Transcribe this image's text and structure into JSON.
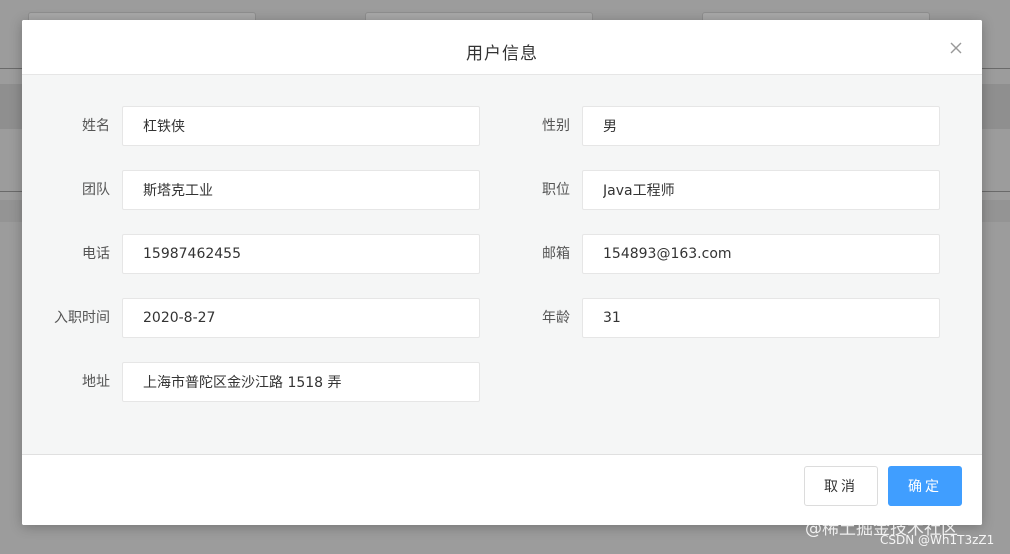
{
  "dialog": {
    "title": "用户信息",
    "close_icon": "close-icon"
  },
  "form": {
    "fields": [
      {
        "label": "姓名",
        "value": "杠铁侠"
      },
      {
        "label": "性别",
        "value": "男"
      },
      {
        "label": "团队",
        "value": "斯塔克工业"
      },
      {
        "label": "职位",
        "value": "Java工程师"
      },
      {
        "label": "电话",
        "value": "15987462455"
      },
      {
        "label": "邮箱",
        "value": "154893@163.com"
      },
      {
        "label": "入职时间",
        "value": "2020-8-27"
      },
      {
        "label": "年龄",
        "value": "31"
      },
      {
        "label": "地址",
        "value": "上海市普陀区金沙江路 1518 弄"
      }
    ]
  },
  "footer": {
    "cancel_label": "取消",
    "confirm_label": "确定"
  },
  "colors": {
    "primary": "#409eff",
    "body_bg": "#f5f6f6"
  },
  "watermark": {
    "line1": "@稀土掘金技术社区",
    "line2": "CSDN @Wh1T3zZ1"
  }
}
